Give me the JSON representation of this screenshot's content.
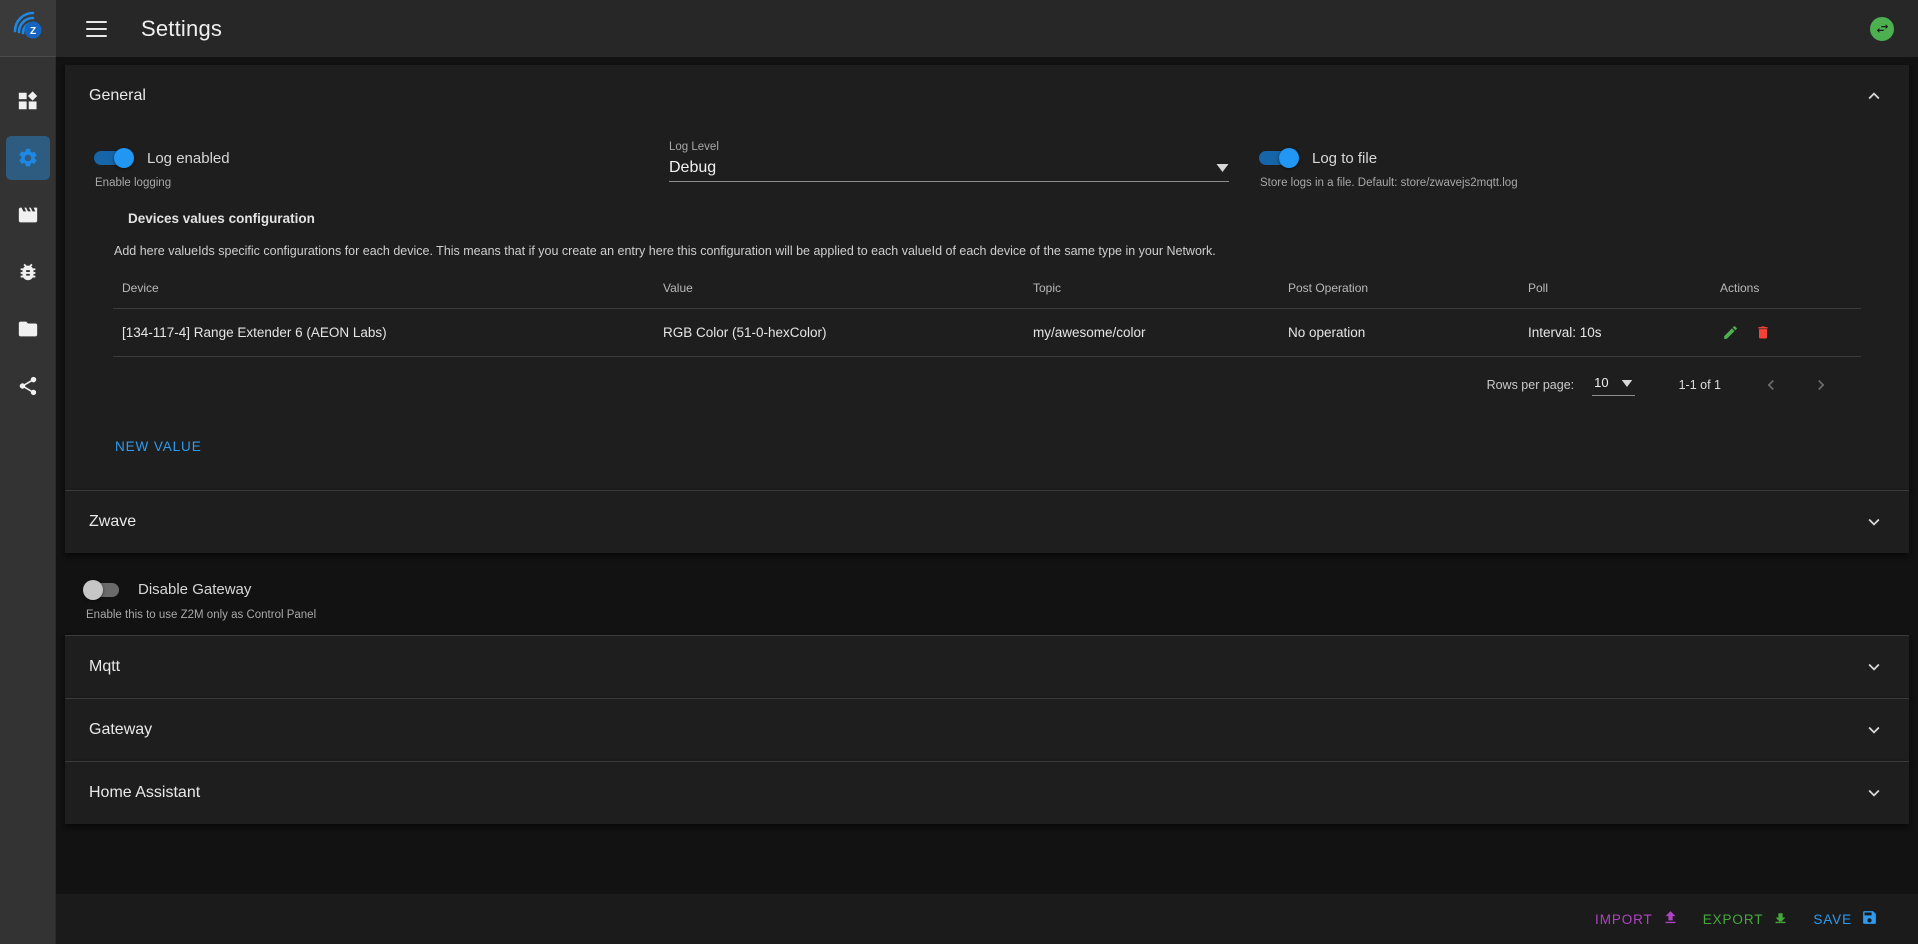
{
  "app": {
    "logo_icon": "zwavejs2mqtt-logo-icon",
    "title": "Settings",
    "menu_icon": "hamburger-menu-icon",
    "status_icon": "connection-status-icon",
    "status_color": "#4caf50"
  },
  "sidebar": {
    "items": [
      {
        "name": "dashboard",
        "icon": "dashboard-grid-icon",
        "active": false
      },
      {
        "name": "settings",
        "icon": "gear-icon",
        "active": true
      },
      {
        "name": "scenes",
        "icon": "clapperboard-icon",
        "active": false
      },
      {
        "name": "debug",
        "icon": "bug-icon",
        "active": false
      },
      {
        "name": "store",
        "icon": "folder-icon",
        "active": false
      },
      {
        "name": "network-graph",
        "icon": "share-nodes-icon",
        "active": false
      }
    ]
  },
  "general": {
    "title": "General",
    "expanded": true,
    "collapse_icon": "chevron-up-icon",
    "log_enabled": {
      "label": "Log enabled",
      "hint": "Enable logging",
      "on": true
    },
    "log_level": {
      "caption": "Log Level",
      "value": "Debug",
      "arrow_icon": "dropdown-arrow-icon"
    },
    "log_to_file": {
      "label": "Log to file",
      "hint": "Store logs in a file. Default: store/zwavejs2mqtt.log",
      "on": true
    },
    "devices_values": {
      "title": "Devices values configuration",
      "description": "Add here valueIds specific configurations for each device. This means that if you create an entry here this configuration will be applied to each valueId of each device of the same type in your Network.",
      "columns": [
        "Device",
        "Value",
        "Topic",
        "Post Operation",
        "Poll",
        "Actions"
      ],
      "rows": [
        {
          "device": "[134-117-4] Range Extender 6 (AEON Labs)",
          "value": "RGB Color (51-0-hexColor)",
          "topic": "my/awesome/color",
          "post_operation": "No operation",
          "poll": "Interval: 10s",
          "edit_icon": "edit-pencil-icon",
          "delete_icon": "delete-trash-icon"
        }
      ],
      "paginator": {
        "rows_per_page_label": "Rows per page:",
        "rows_per_page_value": "10",
        "dropdown_icon": "dropdown-arrow-icon",
        "range": "1-1 of 1",
        "prev_icon": "chevron-left-icon",
        "next_icon": "chevron-right-icon"
      },
      "new_value_button": "NEW VALUE"
    }
  },
  "zwave": {
    "title": "Zwave",
    "expand_icon": "chevron-down-icon"
  },
  "disable_gateway": {
    "label": "Disable Gateway",
    "hint": "Enable this to use Z2M only as Control Panel",
    "on": false
  },
  "sections": [
    {
      "title": "Mqtt",
      "expand_icon": "chevron-down-icon"
    },
    {
      "title": "Gateway",
      "expand_icon": "chevron-down-icon"
    },
    {
      "title": "Home Assistant",
      "expand_icon": "chevron-down-icon"
    }
  ],
  "footer": {
    "import": {
      "label": "IMPORT",
      "icon": "upload-icon",
      "color": "#b043c4"
    },
    "export": {
      "label": "EXPORT",
      "icon": "download-icon",
      "color": "#46a83c"
    },
    "save": {
      "label": "SAVE",
      "icon": "floppy-save-icon",
      "color": "#2e9bf0"
    }
  }
}
